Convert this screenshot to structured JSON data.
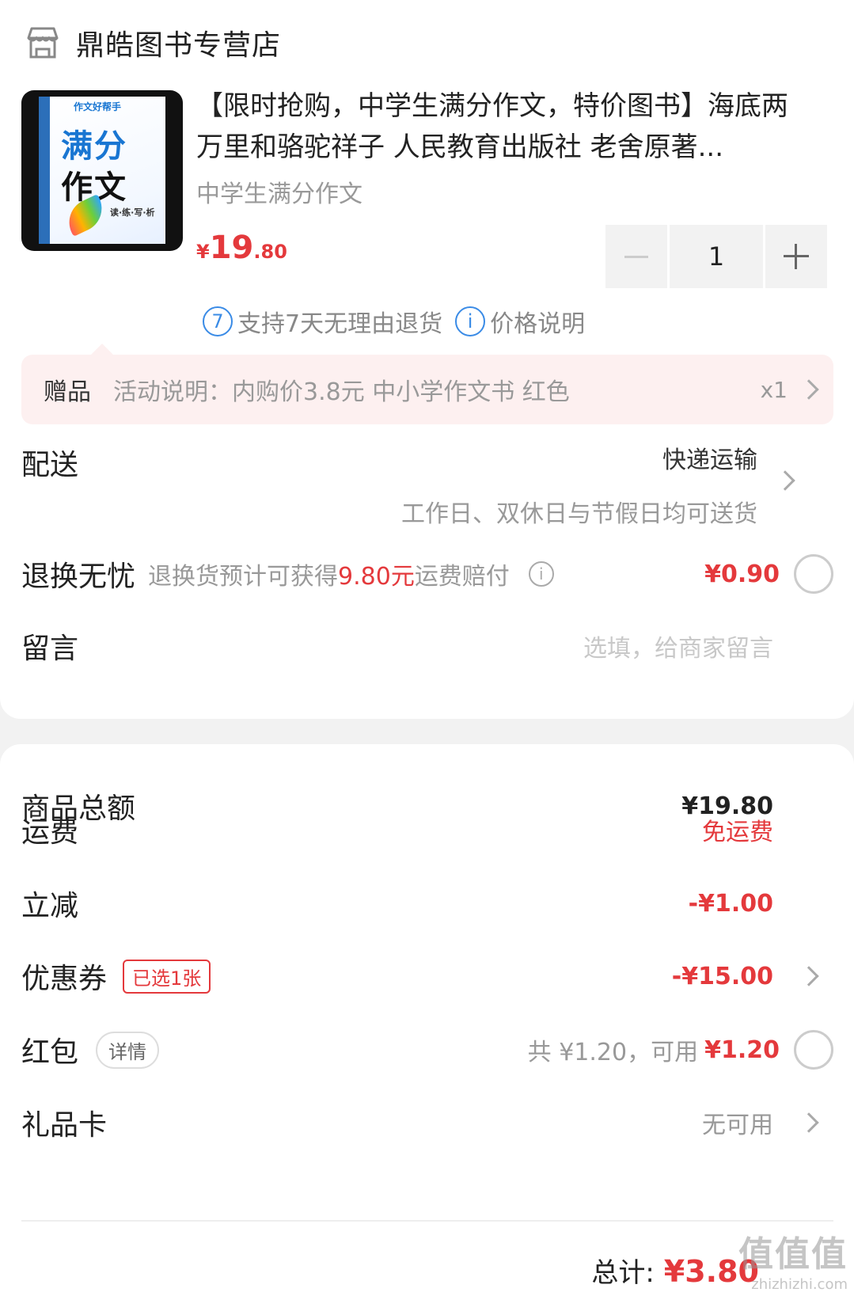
{
  "shop": {
    "name": "鼎皓图书专营店",
    "icon": "store-icon"
  },
  "product": {
    "title": "【限时抢购，中学生满分作文，特价图书】海底两万里和骆驼祥子 人民教育出版社 老舍原著...",
    "subtitle": "中学生满分作文",
    "price_currency": "¥",
    "price_int": "19",
    "price_dec": ".80",
    "quantity": "1",
    "cover_top": "作文好帮手",
    "cover_line1": "满分",
    "cover_line2": "作文",
    "cover_tags": "读·练·写·析"
  },
  "badges": [
    {
      "icon": "7",
      "text": "支持7天无理由退货"
    },
    {
      "icon": "i",
      "text": "价格说明"
    }
  ],
  "gift": {
    "label": "赠品",
    "text": "活动说明：内购价3.8元 中小学作文书 红色",
    "qty": "x1"
  },
  "delivery": {
    "label": "配送",
    "method": "快递运输",
    "note": "工作日、双休日与节假日均可送货"
  },
  "refund": {
    "label": "退换无忧",
    "desc_prefix": "退换货预计可获得",
    "desc_amount": "9.80元",
    "desc_suffix": "运费赔付",
    "price": "¥0.90"
  },
  "message": {
    "label": "留言",
    "placeholder": "选填，给商家留言"
  },
  "summary": {
    "goods_label": "商品总额",
    "goods_value": "¥19.80",
    "shipping_label": "运费",
    "shipping_value": "免运费",
    "discount_label": "立减",
    "discount_value": "-¥1.00",
    "coupon_label": "优惠券",
    "coupon_tag": "已选1张",
    "coupon_value": "-¥15.00",
    "redpacket_label": "红包",
    "redpacket_pill": "详情",
    "redpacket_total": "共 ¥1.20，可用",
    "redpacket_avail": "¥1.20",
    "giftcard_label": "礼品卡",
    "giftcard_value": "无可用"
  },
  "total": {
    "label": "总计:",
    "amount": "¥3.80"
  },
  "watermark": {
    "big": "值值值",
    "small": "zhizhizhi.com"
  },
  "colors": {
    "accent": "#e4393c",
    "info_blue": "#3a8be6",
    "gift_bg": "#fdf0f0"
  }
}
